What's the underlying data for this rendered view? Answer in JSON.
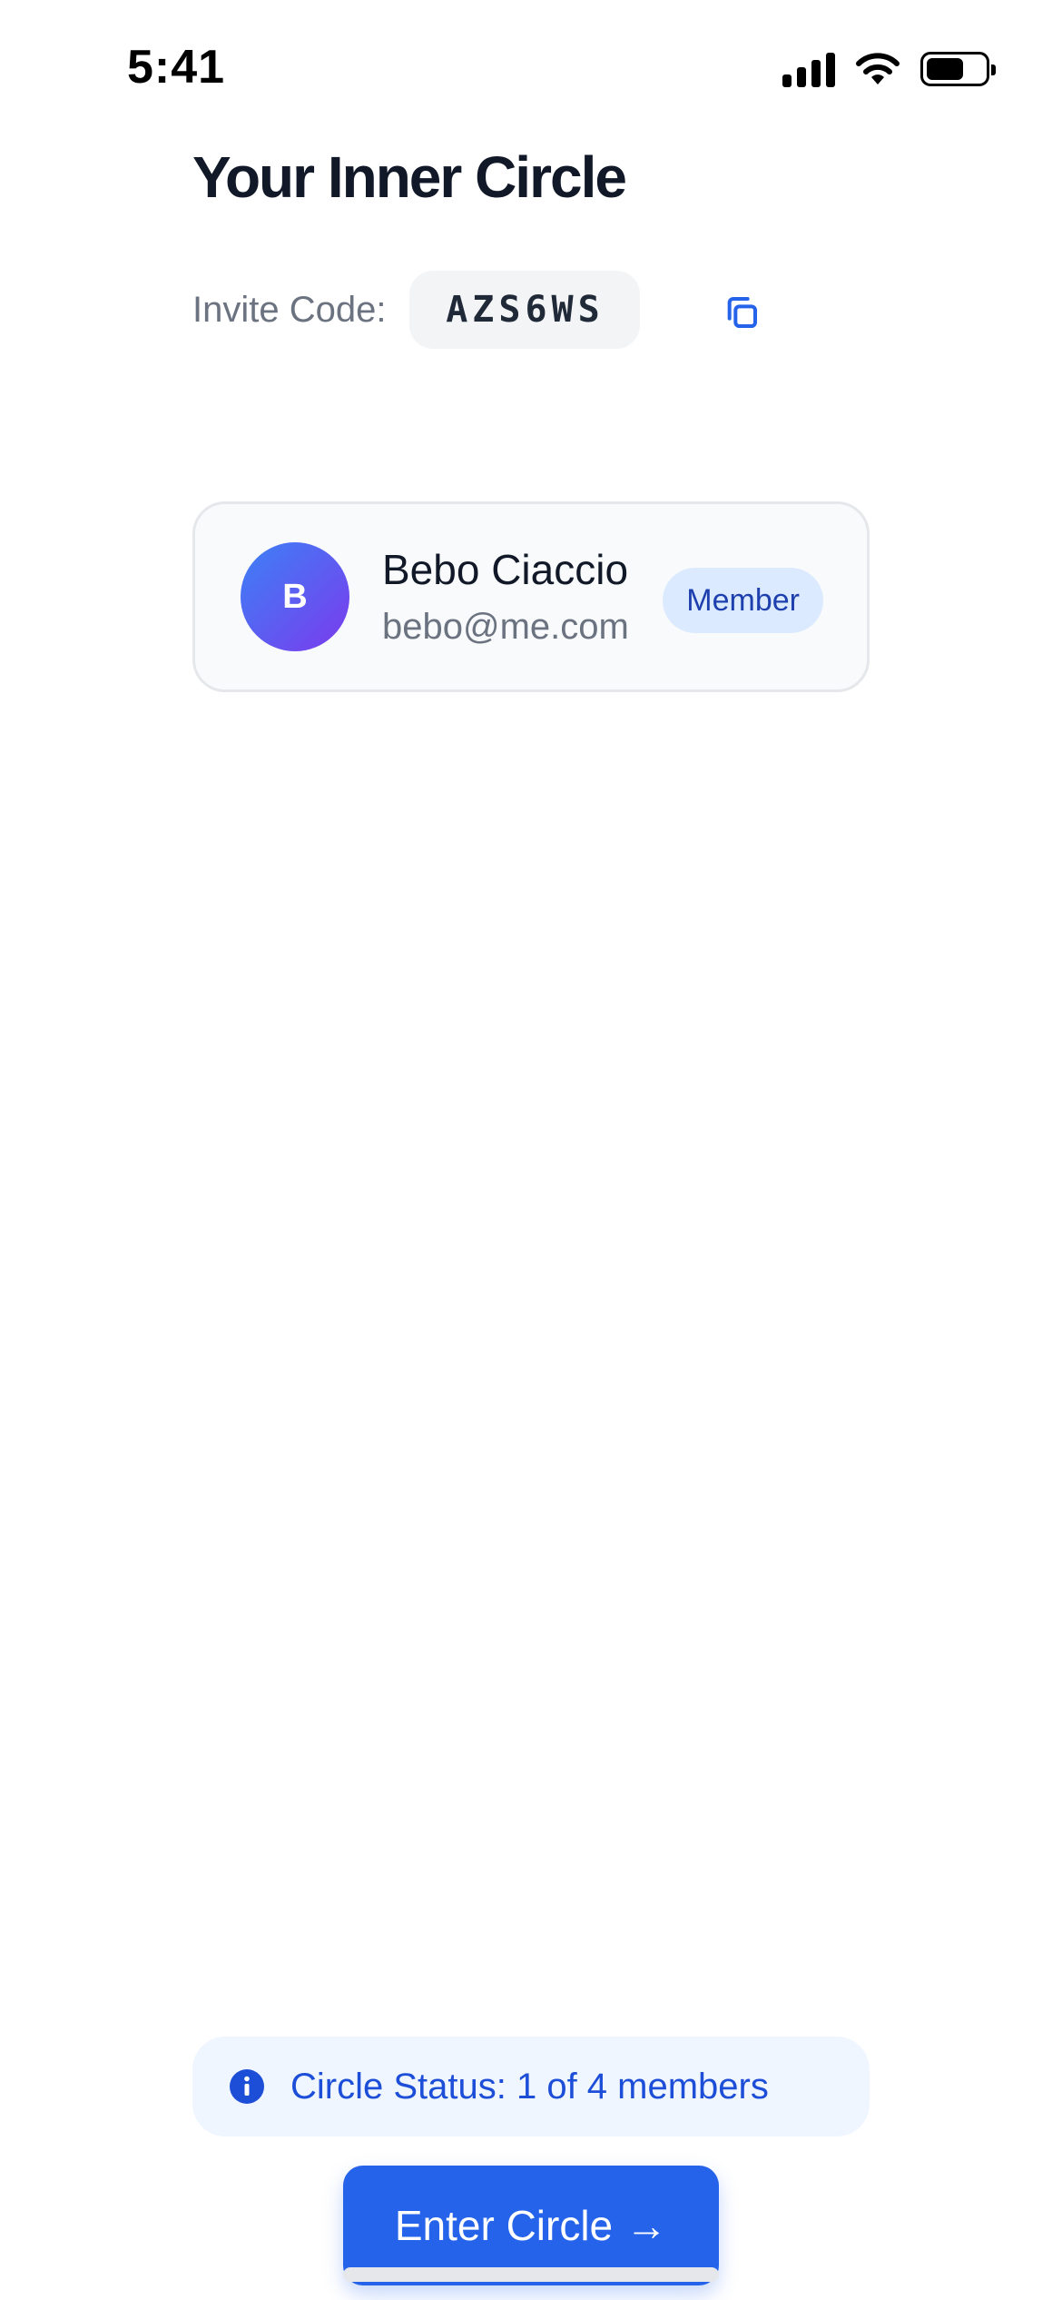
{
  "status_bar": {
    "time": "5:41",
    "battery_level": 0.65,
    "signal_bars": 4,
    "icons": [
      "signal-icon",
      "wifi-icon",
      "battery-icon"
    ]
  },
  "page": {
    "title": "Your Inner Circle"
  },
  "invite": {
    "label": "Invite Code:",
    "code": "AZS6WS",
    "copy_icon": "copy-icon"
  },
  "members": [
    {
      "initial": "B",
      "name": "Bebo Ciaccio",
      "email": "bebo@me.com",
      "role": "Member"
    }
  ],
  "circle_status": {
    "icon": "info-icon",
    "text": "Circle Status: 1 of 4 members"
  },
  "actions": {
    "enter_label": "Enter Circle",
    "enter_arrow": "→"
  },
  "colors": {
    "accent": "#2563eb",
    "badge_bg": "#dbeafe",
    "status_bg": "#eff6ff",
    "avatar_gradient_start": "#3b82f6",
    "avatar_gradient_end": "#7c3aed"
  }
}
